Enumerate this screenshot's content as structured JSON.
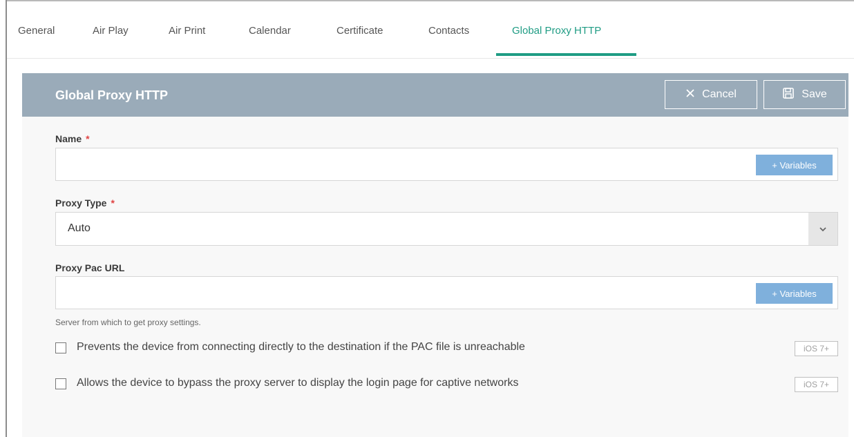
{
  "tabs": [
    {
      "label": "General"
    },
    {
      "label": "Air Play"
    },
    {
      "label": "Air Print"
    },
    {
      "label": "Calendar"
    },
    {
      "label": "Certificate"
    },
    {
      "label": "Contacts"
    },
    {
      "label": "Global Proxy HTTP",
      "active": true
    }
  ],
  "panel": {
    "title": "Global Proxy HTTP",
    "cancel_label": "Cancel",
    "save_label": "Save"
  },
  "fields": {
    "name": {
      "label": "Name",
      "required": "*",
      "value": "",
      "variables_label": "+ Variables"
    },
    "proxy_type": {
      "label": "Proxy Type",
      "required": "*",
      "value": "Auto"
    },
    "proxy_pac_url": {
      "label": "Proxy Pac URL",
      "value": "",
      "variables_label": "+ Variables",
      "helper": "Server from which to get proxy settings."
    }
  },
  "options": [
    {
      "label": "Prevents the device from connecting directly to the destination if the PAC file is unreachable",
      "checked": false,
      "badge": "iOS 7+"
    },
    {
      "label": "Allows the device to bypass the proxy server to display the login page for captive networks",
      "checked": false,
      "badge": "iOS 7+"
    }
  ],
  "colors": {
    "accent": "#1f9c84",
    "header_bg": "#9aabb9",
    "variables_button": "#7fb0dc",
    "required": "#e04343"
  }
}
